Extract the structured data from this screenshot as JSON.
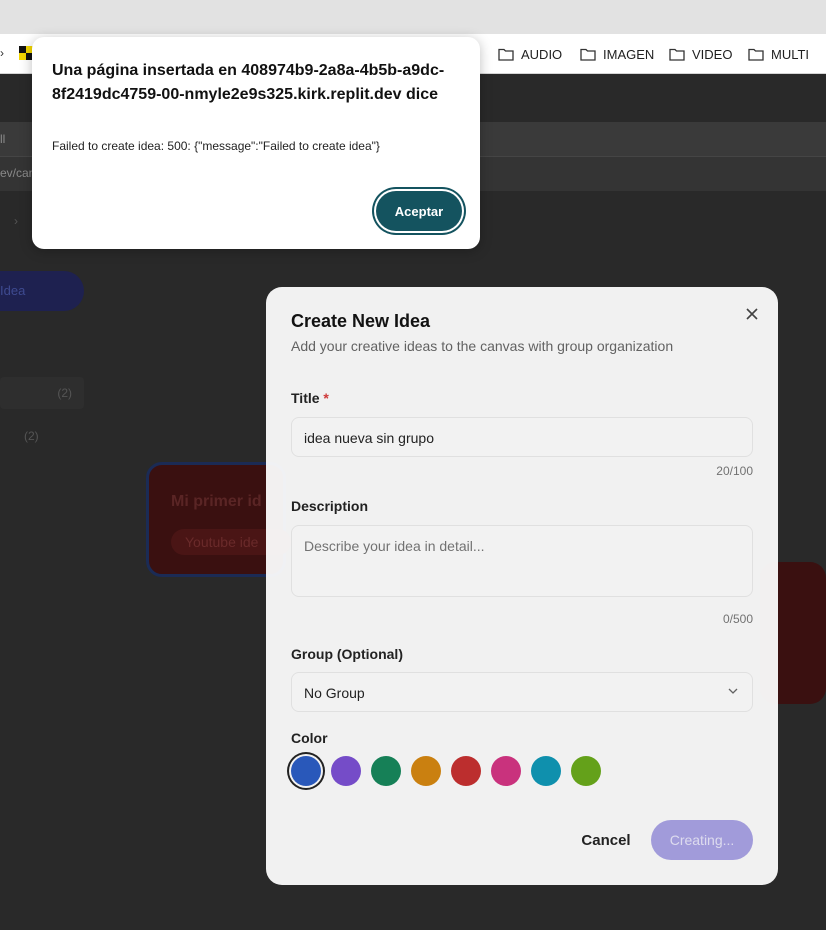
{
  "bookmarks": [
    {
      "label": "AUDIO",
      "icon": "folder-icon"
    },
    {
      "label": "IMAGEN",
      "icon": "folder-icon"
    },
    {
      "label": "VIDEO",
      "icon": "folder-icon"
    },
    {
      "label": "MULTI",
      "icon": "folder-icon"
    }
  ],
  "background": {
    "address_fragment": "ev/can",
    "tab_fragment": "ll",
    "sidebar_button_fragment": "Idea",
    "group_counts": [
      "(2)",
      "(2)"
    ],
    "card_title": "Mi primer id",
    "card_chip": "Youtube ide"
  },
  "modal": {
    "title": "Create New Idea",
    "subtitle": "Add your creative ideas to the canvas with group organization",
    "title_label": "Title",
    "required_mark": "*",
    "title_value": "idea nueva sin grupo",
    "title_counter": "20/100",
    "description_label": "Description",
    "description_placeholder": "Describe your idea in detail...",
    "description_counter": "0/500",
    "group_label": "Group (Optional)",
    "group_value": "No Group",
    "color_label": "Color",
    "colors": [
      "#2a5bc4",
      "#7a4fd2",
      "#15865a",
      "#d5860f",
      "#c62f2f",
      "#d43383",
      "#0e97b6",
      "#68a91a"
    ],
    "selected_color": "#2a5bc4",
    "cancel_label": "Cancel",
    "submit_label": "Creating..."
  },
  "alert": {
    "title": "Una página insertada en 408974b9-2a8a-4b5b-a9dc-8f2419dc4759-00-nmyle2e9s325.kirk.replit.dev dice",
    "message": "Failed to create idea: 500: {\"message\":\"Failed to create idea\"}",
    "button_label": "Aceptar"
  }
}
